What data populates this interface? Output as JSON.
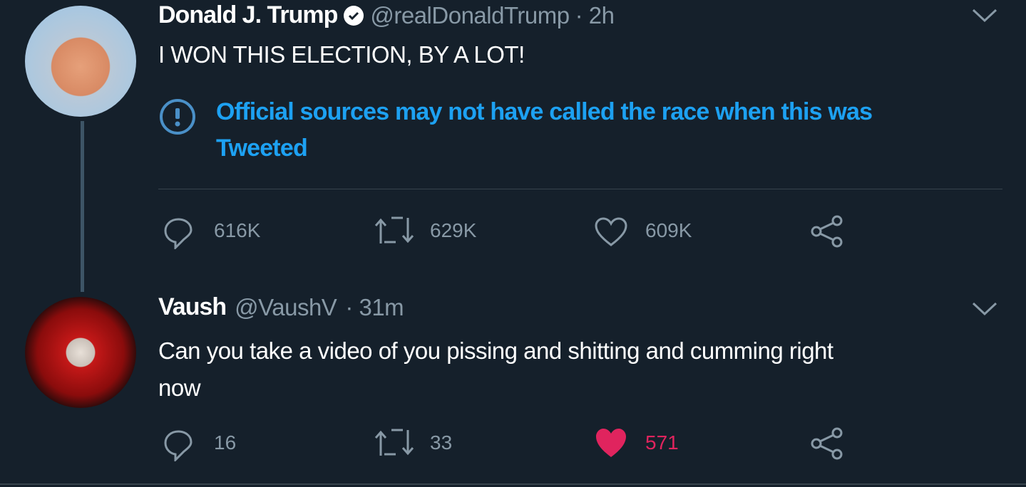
{
  "tweets": [
    {
      "name": "Donald J. Trump",
      "verified": true,
      "handle": "@realDonaldTrump",
      "time": "· 2h",
      "text": "I WON THIS ELECTION, BY A LOT!",
      "notice": {
        "icon": "exclamation-circle-icon",
        "line1": "Official sources may not have called the race when this was",
        "line2": "Tweeted"
      },
      "replies": "616K",
      "retweets": "629K",
      "likes": "609K",
      "liked": false
    },
    {
      "name": "Vaush",
      "handle": "@VaushV",
      "time": "· 31m",
      "text_line1": "Can you take a video of you pissing and shitting and cumming right",
      "text_line2": "now",
      "replies": "16",
      "retweets": "33",
      "likes": "571",
      "liked": true
    }
  ],
  "colors": {
    "background": "#15202b",
    "accent": "#1da1f2",
    "like": "#e0245e",
    "muted": "#8899a6"
  }
}
